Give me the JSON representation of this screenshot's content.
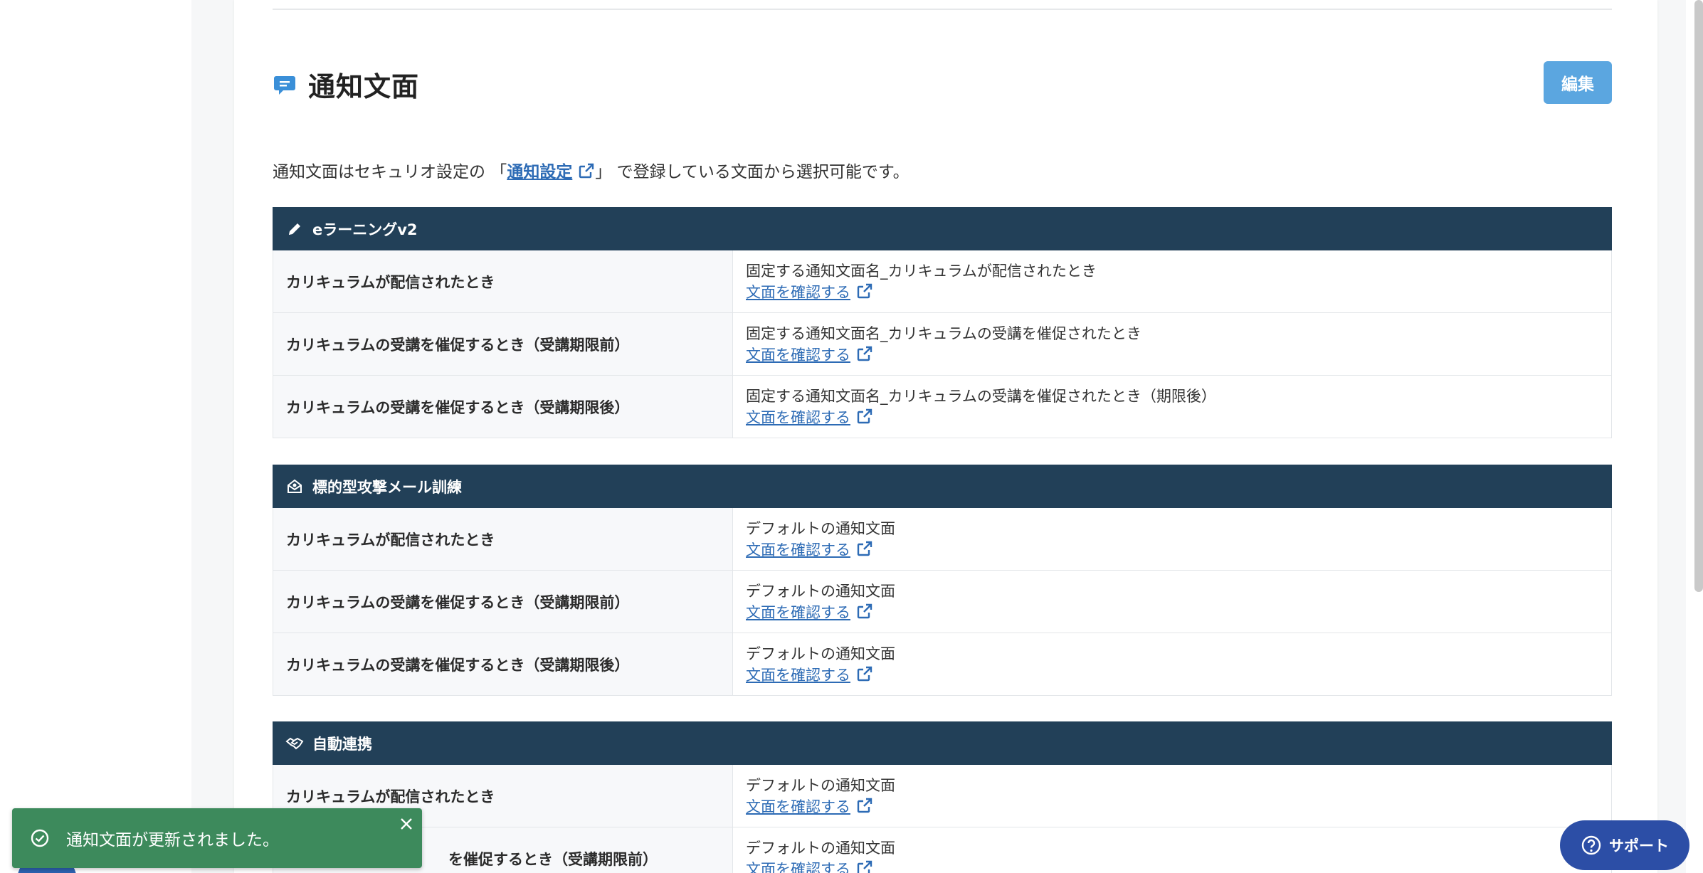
{
  "page": {
    "title": "通知文面",
    "edit_label": "編集",
    "desc_before": "通知文面はセキュリオ設定の 「",
    "desc_link": "通知設定",
    "desc_after": "」 で登録している文面から選択可能です。"
  },
  "sections": [
    {
      "title": "eラーニングv2",
      "icon": "pencil-icon",
      "rows": [
        {
          "label": "カリキュラムが配信されたとき",
          "template": "固定する通知文面名_カリキュラムが配信されたとき",
          "link": "文面を確認する"
        },
        {
          "label": "カリキュラムの受講を催促するとき（受講期限前）",
          "template": "固定する通知文面名_カリキュラムの受講を催促されたとき",
          "link": "文面を確認する"
        },
        {
          "label": "カリキュラムの受講を催促するとき（受講期限後）",
          "template": "固定する通知文面名_カリキュラムの受講を催促されたとき（期限後）",
          "link": "文面を確認する"
        }
      ]
    },
    {
      "title": "標的型攻撃メール訓練",
      "icon": "envelope-open-icon",
      "rows": [
        {
          "label": "カリキュラムが配信されたとき",
          "template": "デフォルトの通知文面",
          "link": "文面を確認する"
        },
        {
          "label": "カリキュラムの受講を催促するとき（受講期限前）",
          "template": "デフォルトの通知文面",
          "link": "文面を確認する"
        },
        {
          "label": "カリキュラムの受講を催促するとき（受講期限後）",
          "template": "デフォルトの通知文面",
          "link": "文面を確認する"
        }
      ]
    },
    {
      "title": "自動連携",
      "icon": "handshake-icon",
      "rows": [
        {
          "label": "カリキュラムが配信されたとき",
          "template": "デフォルトの通知文面",
          "link": "文面を確認する"
        },
        {
          "label": "を催促するとき（受講期限前）",
          "template": "デフォルトの通知文面",
          "link": "文面を確認する"
        }
      ]
    }
  ],
  "toast": {
    "message": "通知文面が更新されました。"
  },
  "support": {
    "label": "サポート"
  },
  "colors": {
    "header_bg": "#224058",
    "accent": "#5ba6e0",
    "link": "#2d6bb5",
    "toast_bg": "#3d8a5c",
    "support_bg": "#2c4ea6"
  }
}
